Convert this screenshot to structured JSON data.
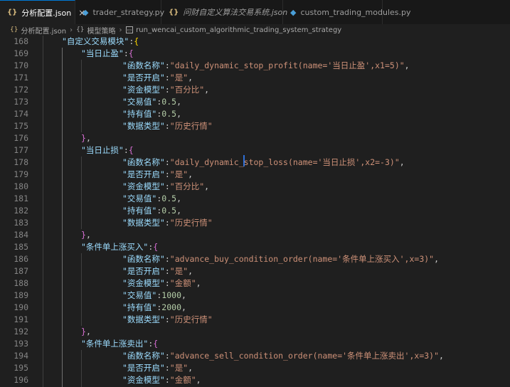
{
  "tabs": [
    {
      "label": "分析配置.json",
      "type": "json",
      "active": true,
      "italic": false
    },
    {
      "label": "trader_strategy.py",
      "type": "py",
      "active": false,
      "italic": false
    },
    {
      "label": "问财自定义算法交易系统.json",
      "type": "json",
      "active": false,
      "italic": true
    },
    {
      "label": "custom_trading_modules.py",
      "type": "py",
      "active": false,
      "italic": false
    }
  ],
  "tab_icons": {
    "json": "{}",
    "py": "◆",
    "close": "×"
  },
  "breadcrumb": {
    "file": "分析配置.json",
    "object": "模型策略",
    "object_icon": "{}",
    "item": "run_wencai_custom_algorithmic_trading_system_strategy"
  },
  "editor": {
    "lines": [
      {
        "n": "168",
        "indent": 1,
        "tokens": [
          [
            "key",
            "\"自定义交易模块\""
          ],
          [
            "pun",
            ":"
          ],
          [
            "br1",
            "{"
          ]
        ]
      },
      {
        "n": "169",
        "indent": 2,
        "tokens": [
          [
            "key",
            "\"当日止盈\""
          ],
          [
            "pun",
            ":"
          ],
          [
            "br2",
            "{"
          ]
        ]
      },
      {
        "n": "170",
        "indent": 3,
        "tokens": [
          [
            "key",
            "\"函数名称\""
          ],
          [
            "pun",
            ":"
          ],
          [
            "str",
            "\"daily_dynamic_stop_profit(name='当日止盈',x1=5)\""
          ],
          [
            "pun",
            ","
          ]
        ]
      },
      {
        "n": "171",
        "indent": 3,
        "tokens": [
          [
            "key",
            "\"是否开启\""
          ],
          [
            "pun",
            ":"
          ],
          [
            "str",
            "\"是\""
          ],
          [
            "pun",
            ","
          ]
        ]
      },
      {
        "n": "172",
        "indent": 3,
        "tokens": [
          [
            "key",
            "\"资金模型\""
          ],
          [
            "pun",
            ":"
          ],
          [
            "str",
            "\"百分比\""
          ],
          [
            "pun",
            ","
          ]
        ]
      },
      {
        "n": "173",
        "indent": 3,
        "tokens": [
          [
            "key",
            "\"交易值\""
          ],
          [
            "pun",
            ":"
          ],
          [
            "num",
            "0.5"
          ],
          [
            "pun",
            ","
          ]
        ]
      },
      {
        "n": "174",
        "indent": 3,
        "tokens": [
          [
            "key",
            "\"持有值\""
          ],
          [
            "pun",
            ":"
          ],
          [
            "num",
            "0.5"
          ],
          [
            "pun",
            ","
          ]
        ]
      },
      {
        "n": "175",
        "indent": 3,
        "tokens": [
          [
            "key",
            "\"数据类型\""
          ],
          [
            "pun",
            ":"
          ],
          [
            "str",
            "\"历史行情\""
          ]
        ]
      },
      {
        "n": "176",
        "indent": 2,
        "tokens": [
          [
            "br2",
            "}"
          ],
          [
            "pun",
            ","
          ]
        ]
      },
      {
        "n": "177",
        "indent": 2,
        "tokens": [
          [
            "key",
            "\"当日止损\""
          ],
          [
            "pun",
            ":"
          ],
          [
            "br2",
            "{"
          ]
        ]
      },
      {
        "n": "178",
        "indent": 3,
        "tokens": [
          [
            "key",
            "\"函数名称\""
          ],
          [
            "pun",
            ":"
          ],
          [
            "str",
            "\"daily_dynamic_stop_loss(name='当日止损',x2=-3)\""
          ],
          [
            "pun",
            ","
          ]
        ]
      },
      {
        "n": "179",
        "indent": 3,
        "tokens": [
          [
            "key",
            "\"是否开启\""
          ],
          [
            "pun",
            ":"
          ],
          [
            "str",
            "\"是\""
          ],
          [
            "pun",
            ","
          ]
        ]
      },
      {
        "n": "180",
        "indent": 3,
        "tokens": [
          [
            "key",
            "\"资金模型\""
          ],
          [
            "pun",
            ":"
          ],
          [
            "str",
            "\"百分比\""
          ],
          [
            "pun",
            ","
          ]
        ]
      },
      {
        "n": "181",
        "indent": 3,
        "tokens": [
          [
            "key",
            "\"交易值\""
          ],
          [
            "pun",
            ":"
          ],
          [
            "num",
            "0.5"
          ],
          [
            "pun",
            ","
          ]
        ]
      },
      {
        "n": "182",
        "indent": 3,
        "tokens": [
          [
            "key",
            "\"持有值\""
          ],
          [
            "pun",
            ":"
          ],
          [
            "num",
            "0.5"
          ],
          [
            "pun",
            ","
          ]
        ]
      },
      {
        "n": "183",
        "indent": 3,
        "tokens": [
          [
            "key",
            "\"数据类型\""
          ],
          [
            "pun",
            ":"
          ],
          [
            "str",
            "\"历史行情\""
          ]
        ]
      },
      {
        "n": "184",
        "indent": 2,
        "tokens": [
          [
            "br2",
            "}"
          ],
          [
            "pun",
            ","
          ]
        ]
      },
      {
        "n": "185",
        "indent": 2,
        "tokens": [
          [
            "key",
            "\"条件单上涨买入\""
          ],
          [
            "pun",
            ":"
          ],
          [
            "br2",
            "{"
          ]
        ]
      },
      {
        "n": "186",
        "indent": 3,
        "tokens": [
          [
            "key",
            "\"函数名称\""
          ],
          [
            "pun",
            ":"
          ],
          [
            "str",
            "\"advance_buy_condition_order(name='条件单上涨买入',x=3)\""
          ],
          [
            "pun",
            ","
          ]
        ]
      },
      {
        "n": "187",
        "indent": 3,
        "tokens": [
          [
            "key",
            "\"是否开启\""
          ],
          [
            "pun",
            ":"
          ],
          [
            "str",
            "\"是\""
          ],
          [
            "pun",
            ","
          ]
        ]
      },
      {
        "n": "188",
        "indent": 3,
        "tokens": [
          [
            "key",
            "\"资金模型\""
          ],
          [
            "pun",
            ":"
          ],
          [
            "str",
            "\"金额\""
          ],
          [
            "pun",
            ","
          ]
        ]
      },
      {
        "n": "189",
        "indent": 3,
        "tokens": [
          [
            "key",
            "\"交易值\""
          ],
          [
            "pun",
            ":"
          ],
          [
            "num",
            "1000"
          ],
          [
            "pun",
            ","
          ]
        ]
      },
      {
        "n": "190",
        "indent": 3,
        "tokens": [
          [
            "key",
            "\"持有值\""
          ],
          [
            "pun",
            ":"
          ],
          [
            "num",
            "2000"
          ],
          [
            "pun",
            ","
          ]
        ]
      },
      {
        "n": "191",
        "indent": 3,
        "tokens": [
          [
            "key",
            "\"数据类型\""
          ],
          [
            "pun",
            ":"
          ],
          [
            "str",
            "\"历史行情\""
          ]
        ]
      },
      {
        "n": "192",
        "indent": 2,
        "tokens": [
          [
            "br2",
            "}"
          ],
          [
            "pun",
            ","
          ]
        ]
      },
      {
        "n": "193",
        "indent": 2,
        "tokens": [
          [
            "key",
            "\"条件单上涨卖出\""
          ],
          [
            "pun",
            ":"
          ],
          [
            "br2",
            "{"
          ]
        ]
      },
      {
        "n": "194",
        "indent": 3,
        "tokens": [
          [
            "key",
            "\"函数名称\""
          ],
          [
            "pun",
            ":"
          ],
          [
            "str",
            "\"advance_sell_condition_order(name='条件单上涨卖出',x=3)\""
          ],
          [
            "pun",
            ","
          ]
        ]
      },
      {
        "n": "195",
        "indent": 3,
        "tokens": [
          [
            "key",
            "\"是否开启\""
          ],
          [
            "pun",
            ":"
          ],
          [
            "str",
            "\"是\""
          ],
          [
            "pun",
            ","
          ]
        ]
      },
      {
        "n": "196",
        "indent": 3,
        "tokens": [
          [
            "key",
            "\"资金模型\""
          ],
          [
            "pun",
            ":"
          ],
          [
            "str",
            "\"金额\""
          ],
          [
            "pun",
            ","
          ]
        ]
      }
    ]
  },
  "colors": {
    "background": "#1f1f1f",
    "key": "#9cdcfe",
    "string": "#ce9178",
    "number": "#b5cea8",
    "bracket_level1": "#ffd700",
    "bracket_level2": "#da70d6",
    "cursor": "#2f6fd6"
  }
}
